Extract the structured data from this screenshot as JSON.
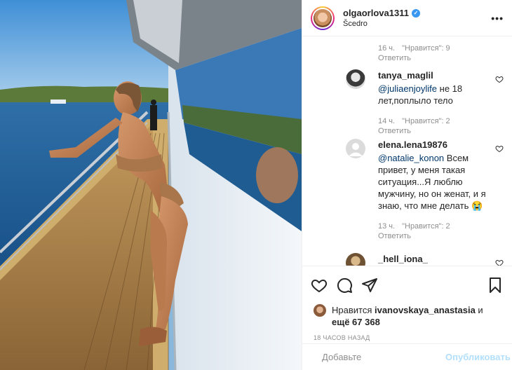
{
  "post": {
    "username": "olgaorlova1311",
    "location": "Šcedro",
    "more_icon": "more-options-icon"
  },
  "first_meta": {
    "time": "16 ч.",
    "likes": "\"Нравится\": 9",
    "reply": "Ответить"
  },
  "comments": [
    {
      "username": "tanya_maglil",
      "mention": "@juliaenjoylife",
      "text": " не 18 лет,поплыло тело",
      "time": "14 ч.",
      "likes": "\"Нравится\": 2",
      "reply": "Ответить"
    },
    {
      "username": "elena.lena19876",
      "mention": "@natalie_konon",
      "text": " Всем привет, у меня такая ситуация...Я люблю мужчину, но он женат, и я знаю, что мне делать 😭",
      "time": "13 ч.",
      "likes": "\"Нравится\": 2",
      "reply": "Ответить"
    },
    {
      "username": "_hell_iona_"
    }
  ],
  "actions": {
    "like_icon": "heart-icon",
    "comment_icon": "comment-icon",
    "share_icon": "share-icon",
    "save_icon": "bookmark-icon"
  },
  "likes": {
    "prefix": "Нравится ",
    "user": "ivanovskaya_anastasia",
    "middle": " и",
    "others": "ещё 67 368"
  },
  "timestamp": "18 часов назад",
  "add_comment": {
    "placeholder": "Добавьте",
    "post_label": "Опубликовать"
  },
  "colors": {
    "link": "#00376b",
    "muted": "#8e8e8e",
    "publish_disabled": "#b2dffc",
    "verified": "#3897f0"
  }
}
